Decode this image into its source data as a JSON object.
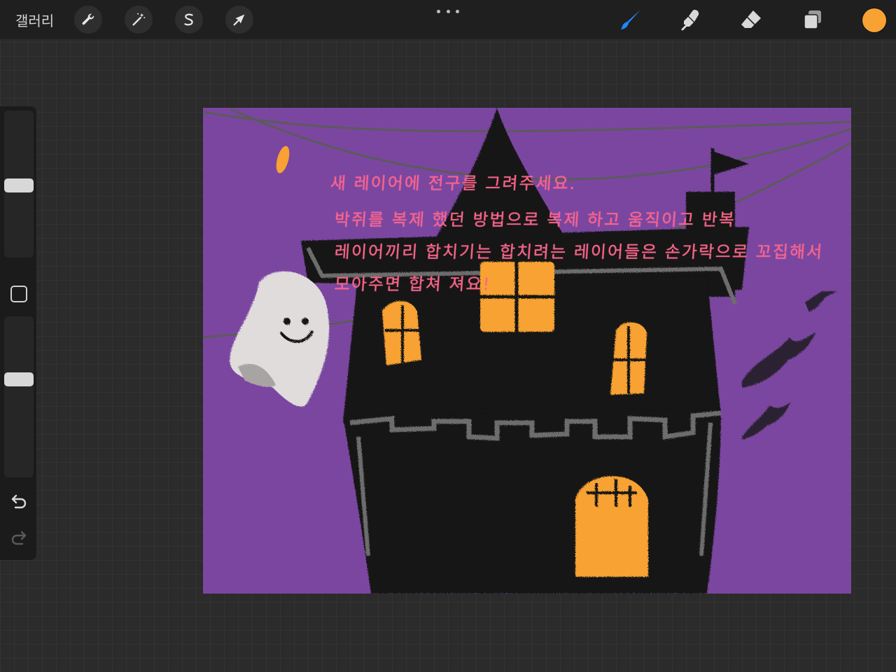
{
  "toolbar": {
    "gallery_label": "갤러리",
    "left_tools": [
      {
        "name": "actions",
        "icon": "wrench-icon"
      },
      {
        "name": "adjustments",
        "icon": "magic-wand-icon"
      },
      {
        "name": "selection",
        "icon": "selection-s-icon"
      },
      {
        "name": "transform",
        "icon": "arrow-cursor-icon"
      }
    ],
    "right_tools": [
      {
        "name": "brush",
        "icon": "brush-icon",
        "active": true,
        "color": "#1e88ff"
      },
      {
        "name": "smudge",
        "icon": "smudge-finger-icon"
      },
      {
        "name": "eraser",
        "icon": "eraser-icon"
      },
      {
        "name": "layers",
        "icon": "layers-icon"
      }
    ],
    "current_color": "#f7a233"
  },
  "sidebar": {
    "brush_size": 0.49,
    "opacity": 0.62
  },
  "canvas": {
    "background_color": "#7b46a0",
    "annotation": {
      "line1": "새 레이어에 전구를 그려주세요.",
      "line2": "박쥐를 복제 했던 방법으로 복제 하고 움직이고 반복",
      "line3": "레이어끼리 합치기는 합치려는 레이어들은 손가락으로 꼬집해서",
      "line4": "모아주면 합쳐 져요!"
    },
    "annotation_color": "#ff5f87"
  }
}
